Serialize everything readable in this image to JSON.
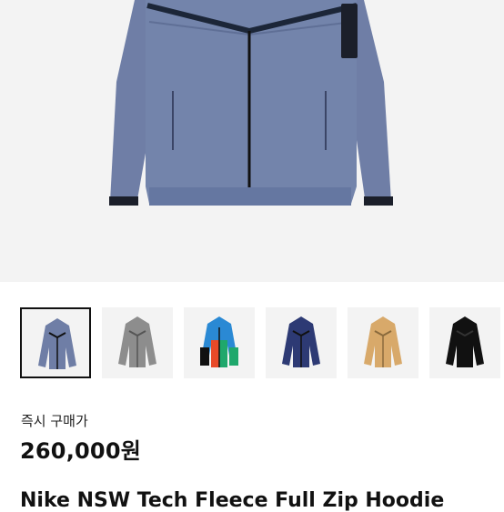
{
  "product": {
    "price_label": "즉시 구매가",
    "price": "260,000원",
    "title": "Nike NSW Tech Fleece Full Zip Hoodie"
  },
  "colors": {
    "main_jacket": "#6f7ea6",
    "accent": "#111111"
  },
  "thumbnails": [
    {
      "color_name": "blue-gray",
      "color": "#6f7ea6",
      "selected": true
    },
    {
      "color_name": "gray",
      "color": "#8d8d8d",
      "selected": false
    },
    {
      "color_name": "multicolor",
      "color": "#2a89d4",
      "selected": false
    },
    {
      "color_name": "navy",
      "color": "#2d3a74",
      "selected": false
    },
    {
      "color_name": "tan",
      "color": "#d8a96a",
      "selected": false
    },
    {
      "color_name": "black",
      "color": "#111111",
      "selected": false
    }
  ]
}
